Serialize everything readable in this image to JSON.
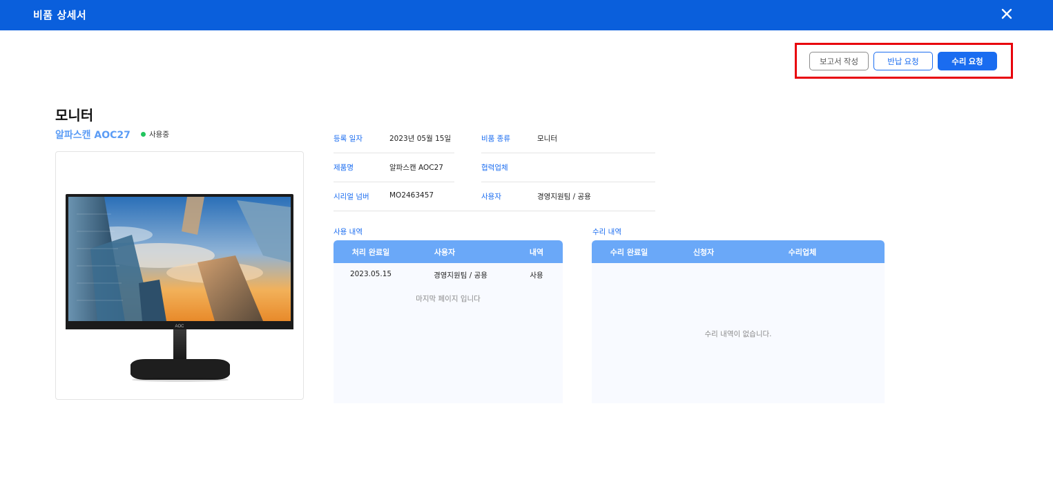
{
  "header": {
    "title": "비품 상세서",
    "close_icon": "close-icon"
  },
  "actions": {
    "report_label": "보고서 작성",
    "return_label": "반납 요청",
    "repair_label": "수리 요청"
  },
  "item": {
    "category_title": "모니터",
    "model": "알파스캔 AOC27",
    "status": "사용중",
    "status_color": "#22c55e",
    "image_brand": "AOC"
  },
  "info": {
    "reg_date_label": "등록 일자",
    "reg_date_value": "2023년 05월 15일",
    "type_label": "비품 종류",
    "type_value": "모니터",
    "product_label": "제품명",
    "product_value": "알파스캔 AOC27",
    "vendor_label": "협력업체",
    "vendor_value": "",
    "serial_label": "시리얼 넘버",
    "serial_value": "MO2463457",
    "user_label": "사용자",
    "user_value": "경영지원팀 / 공용"
  },
  "usage": {
    "title": "사용 내역",
    "columns": [
      "처리 완료일",
      "사용자",
      "내역"
    ],
    "rows": [
      [
        "2023.05.15",
        "경영지원팀 / 공용",
        "사용"
      ]
    ],
    "footer": "마지막 페이지 입니다"
  },
  "repair": {
    "title": "수리 내역",
    "columns": [
      "수리 완료일",
      "신청자",
      "수리업체"
    ],
    "empty": "수리 내역이 없습니다."
  },
  "colors": {
    "header": "#0a5fdc",
    "accent": "#1a6cf0",
    "table_head": "#6aa8f8",
    "highlight": "#e8000b"
  }
}
